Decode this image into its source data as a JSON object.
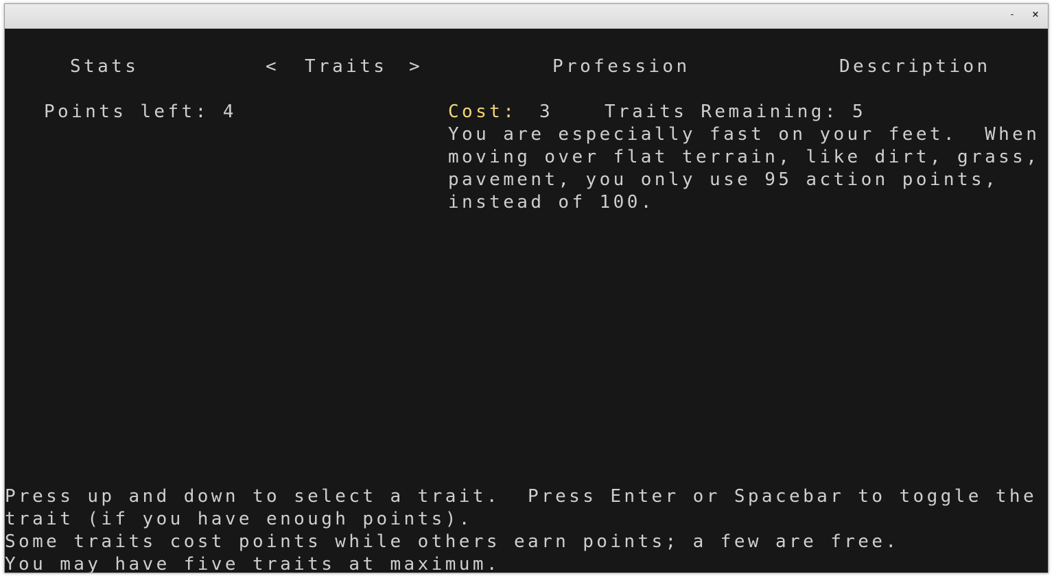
{
  "window": {
    "minimize_label": "-",
    "close_label": "×"
  },
  "tabs": {
    "stats": "Stats",
    "prev_arrow": "<",
    "traits": "Traits",
    "next_arrow": ">",
    "profession": "Profession",
    "description": "Description"
  },
  "points_left": "Points left: 4",
  "trait_info": {
    "cost_label": "Cost:",
    "cost_value": "3",
    "traits_remaining": "Traits Remaining: 5",
    "description_lines": [
      "You are especially fast on your feet.  When",
      "moving over flat terrain, like dirt, grass, or",
      "pavement, you only use 95 action points,",
      "instead of 100."
    ]
  },
  "help_lines": [
    "Press up and down to select a trait.  Press Enter or Spacebar to toggle the",
    "trait (if you have enough points).",
    "Some traits cost points while others earn points; a few are free.",
    "You may have five traits at maximum."
  ],
  "colors": {
    "background": "#171717",
    "text": "#cfcfcf",
    "highlight": "#f4d67a"
  }
}
